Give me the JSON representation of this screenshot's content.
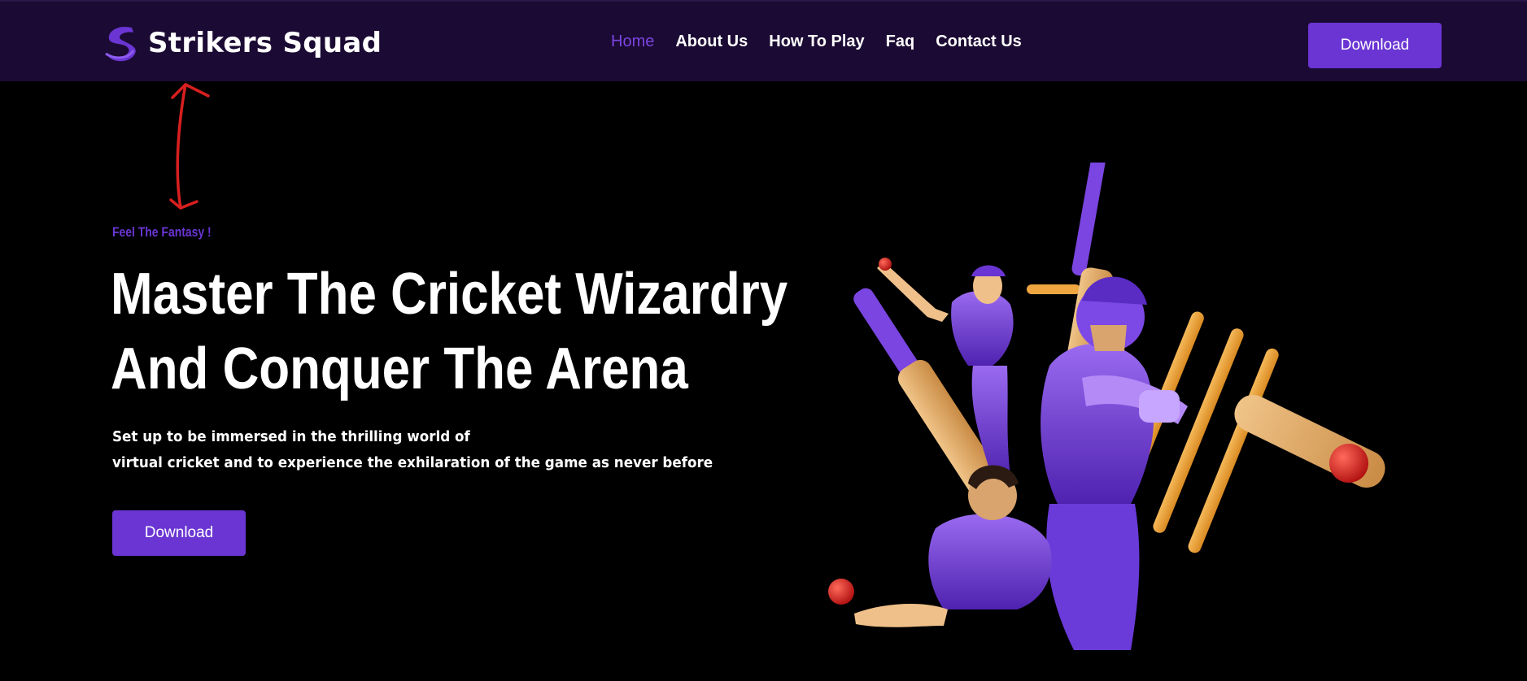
{
  "brand": {
    "name": "Strikers Squad",
    "accent_color": "#6a35d3",
    "header_bg": "#1b0a33"
  },
  "nav": {
    "items": [
      {
        "label": "Home",
        "active": true
      },
      {
        "label": "About Us",
        "active": false
      },
      {
        "label": "How To Play",
        "active": false
      },
      {
        "label": "Faq",
        "active": false
      },
      {
        "label": "Contact Us",
        "active": false
      }
    ],
    "download_label": "Download"
  },
  "hero": {
    "tagline": "Feel The Fantasy !",
    "headline_line1": "Master The Cricket Wizardry",
    "headline_line2": "And Conquer The Arena",
    "subtext_line1": "Set up to be immersed in the thrilling world of",
    "subtext_line2": "virtual cricket and to experience the exhilaration of the game as never before",
    "download_label": "Download",
    "illustration": "cricket-players-illustration"
  },
  "annotation": {
    "icon": "double-headed-arrow-icon",
    "color": "#d81f1f"
  }
}
